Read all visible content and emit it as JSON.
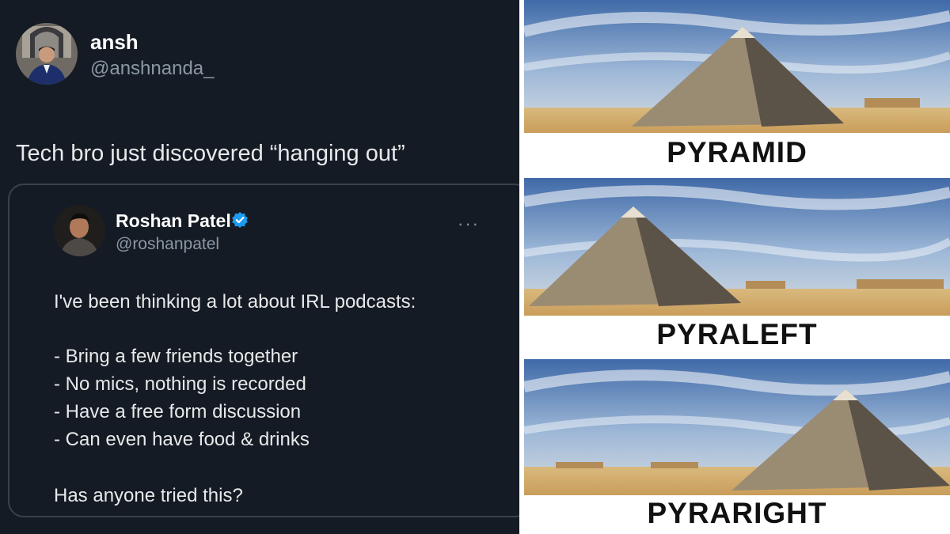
{
  "tweet": {
    "author": {
      "name": "ansh",
      "handle": "@anshnanda_"
    },
    "text": "Tech bro just discovered “hanging out”",
    "quoted": {
      "name": "Roshan Patel",
      "handle": "@roshanpatel",
      "verified": true,
      "more_icon": "more-horizontal-icon",
      "lines": [
        "I've been thinking a lot about IRL podcasts:",
        "- Bring a few friends together",
        "- No mics, nothing is recorded",
        "- Have a free form discussion",
        "- Can even have food & drinks",
        "Has anyone tried this?"
      ]
    }
  },
  "meme": {
    "captions": [
      "PYRAMID",
      "PYRALEFT",
      "PYRARIGHT"
    ]
  },
  "colors": {
    "background": "#151b24",
    "text": "#e7e9ea",
    "muted": "#8b98a5",
    "verified": "#1d9bf0",
    "card_border": "#3a414b"
  }
}
